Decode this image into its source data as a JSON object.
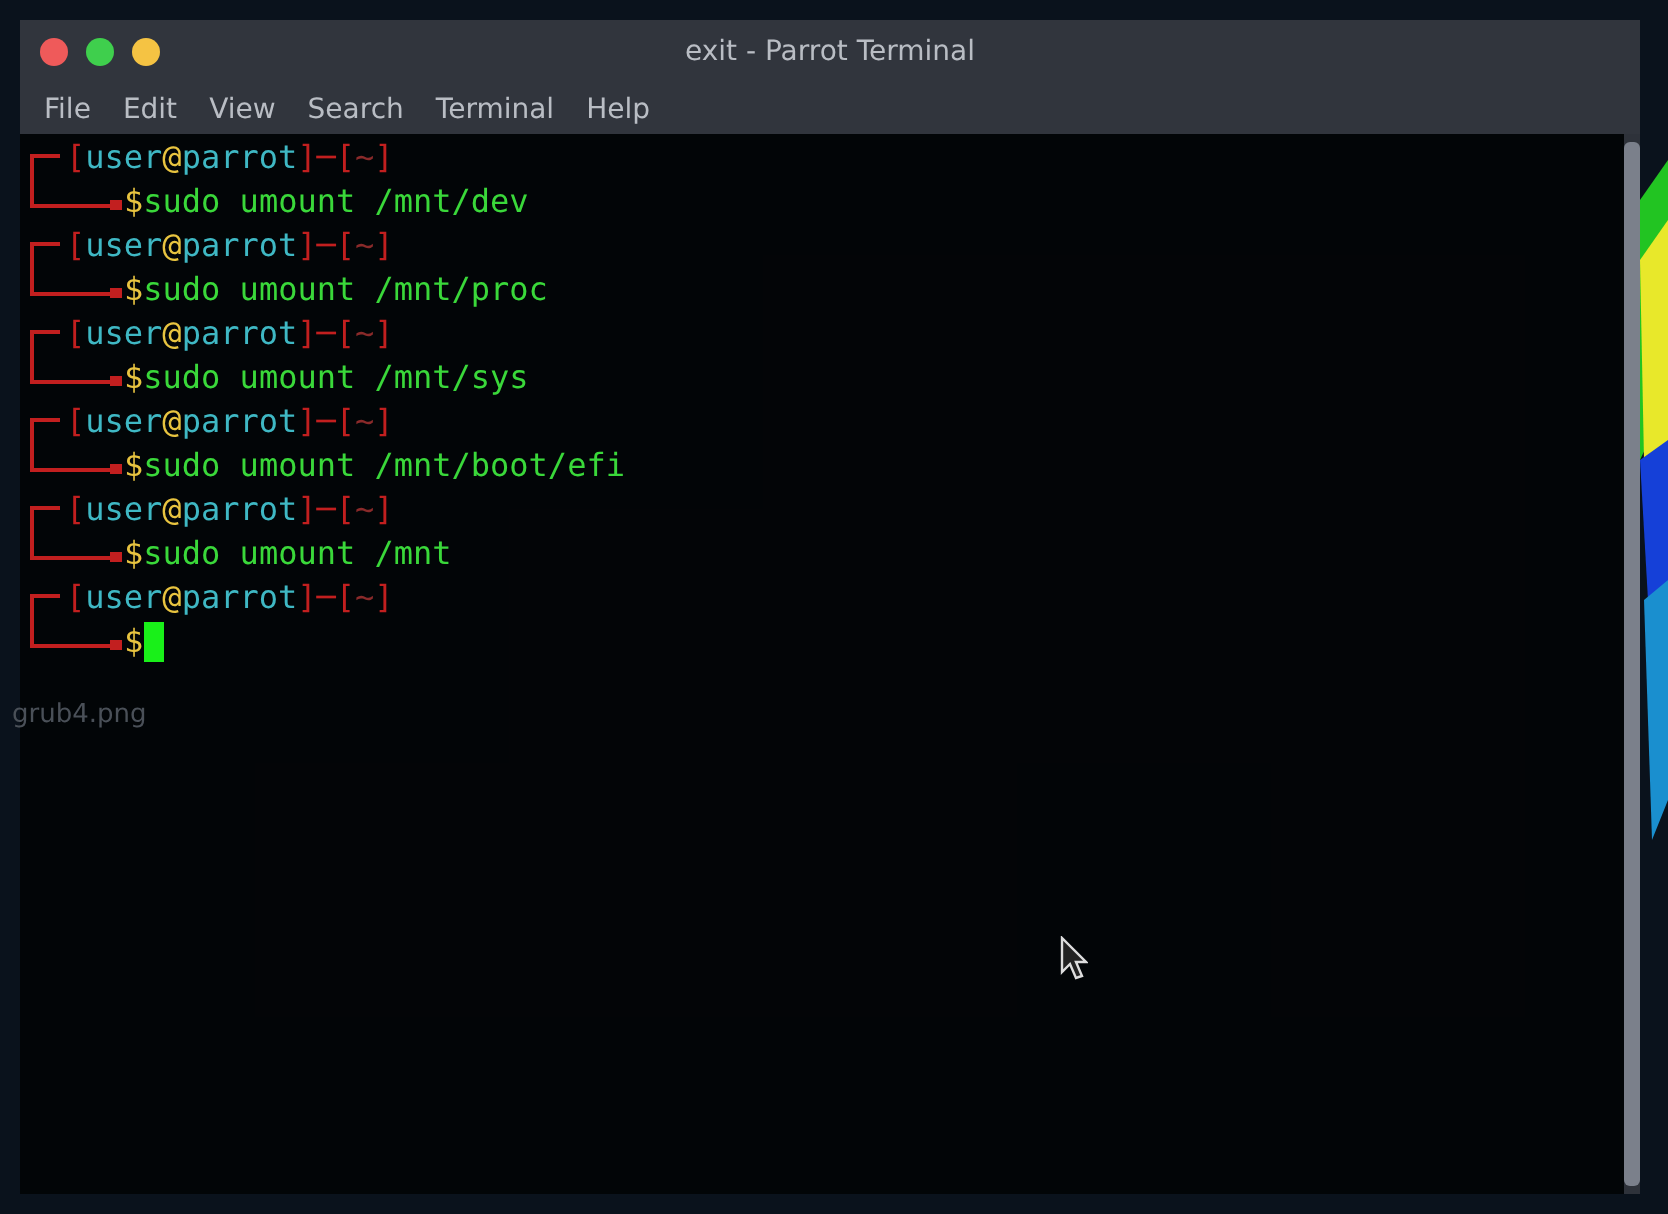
{
  "desktop": {
    "files": [
      {
        "label": "grub4.png"
      }
    ]
  },
  "window": {
    "title": "exit - Parrot Terminal",
    "controls": [
      {
        "color": "#ef5a5a"
      },
      {
        "color": "#3fcf4d"
      },
      {
        "color": "#f5c343"
      }
    ],
    "menu": [
      "File",
      "Edit",
      "View",
      "Search",
      "Terminal",
      "Help"
    ]
  },
  "terminal": {
    "lines": [
      {
        "kind": "done",
        "open": "[",
        "user": "user",
        "at": "@",
        "host": "parrot",
        "sep": "]─[",
        "dir": "~",
        "close": "]",
        "dollar": "$",
        "command": "sudo umount /mnt/dev"
      },
      {
        "kind": "done",
        "open": "[",
        "user": "user",
        "at": "@",
        "host": "parrot",
        "sep": "]─[",
        "dir": "~",
        "close": "]",
        "dollar": "$",
        "command": "sudo umount /mnt/proc"
      },
      {
        "kind": "done",
        "open": "[",
        "user": "user",
        "at": "@",
        "host": "parrot",
        "sep": "]─[",
        "dir": "~",
        "close": "]",
        "dollar": "$",
        "command": "sudo umount /mnt/sys"
      },
      {
        "kind": "done",
        "open": "[",
        "user": "user",
        "at": "@",
        "host": "parrot",
        "sep": "]─[",
        "dir": "~",
        "close": "]",
        "dollar": "$",
        "command": "sudo umount /mnt/boot/efi"
      },
      {
        "kind": "done",
        "open": "[",
        "user": "user",
        "at": "@",
        "host": "parrot",
        "sep": "]─[",
        "dir": "~",
        "close": "]",
        "dollar": "$",
        "command": "sudo umount /mnt"
      },
      {
        "kind": "active",
        "open": "[",
        "user": "user",
        "at": "@",
        "host": "parrot",
        "sep": "]─[",
        "dir": "~",
        "close": "]",
        "dollar": "$"
      }
    ]
  }
}
